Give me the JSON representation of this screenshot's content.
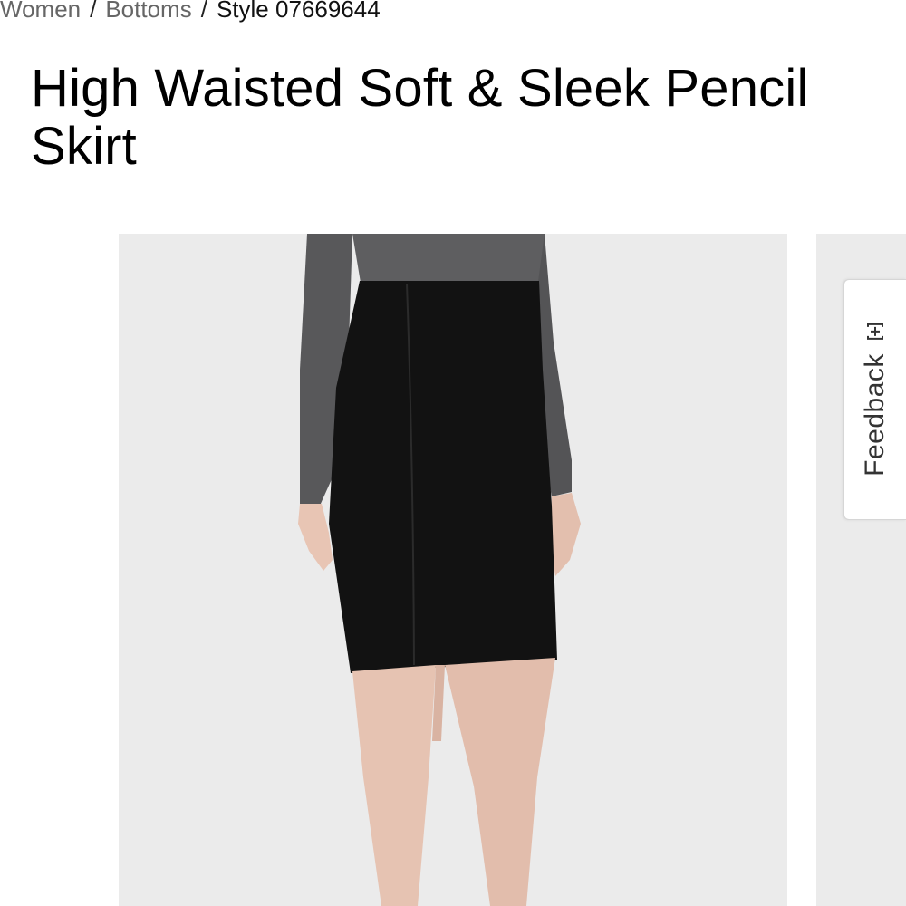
{
  "breadcrumb": {
    "items": [
      {
        "label": "Women"
      },
      {
        "label": "Bottoms"
      }
    ],
    "separator": "/",
    "current": "Style 07669644"
  },
  "product": {
    "title": "High Waisted Soft & Sleek Pencil Skirt"
  },
  "gallery": {
    "main_image": "black-pencil-skirt-model-photo",
    "next_image": "next-product-photo-partial"
  },
  "feedback": {
    "label": "Feedback",
    "icon": "plus-box-icon"
  },
  "colors": {
    "image_background": "#ebebeb",
    "skirt": "#121212",
    "top": "#58585a",
    "skin": "#e8c5b4"
  }
}
